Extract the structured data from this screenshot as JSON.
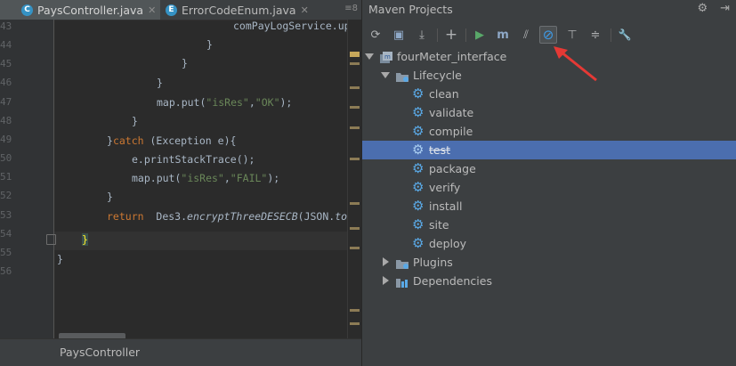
{
  "editor": {
    "tabs": [
      {
        "icon": "C",
        "label": "PaysController.java"
      },
      {
        "icon": "E",
        "label": "ErrorCodeEnum.java"
      }
    ],
    "tab_overflow": "≡8",
    "line_numbers": [
      "43",
      "44",
      "45",
      "46",
      "47",
      "48",
      "49",
      "50",
      "51",
      "52",
      "53",
      "54",
      "55",
      "56"
    ],
    "code": {
      "l43": "comPayLogService.up",
      "l44": "}",
      "l45": "}",
      "l46": "}",
      "l47_a": "map.put(",
      "l47_s1": "\"isRes\"",
      "l47_c": ",",
      "l47_s2": "\"OK\"",
      "l47_e": ");",
      "l48": "}",
      "l49_a": "}",
      "l49_kw": "catch",
      "l49_b": " (Exception e){",
      "l50": "e.printStackTrace();",
      "l51_a": "map.put(",
      "l51_s1": "\"isRes\"",
      "l51_c": ",",
      "l51_s2": "\"FAIL\"",
      "l51_e": ");",
      "l52": "}",
      "l53_kw": "return",
      "l53_a": "  Des3.",
      "l53_it": "encryptThreeDESECB",
      "l53_b": "(JSON.",
      "l53_it2": "toJ",
      "l54": "}",
      "l55": "}"
    },
    "status": "PaysController"
  },
  "maven": {
    "title": "Maven Projects",
    "toolbar": [
      {
        "icon": "refresh-icon",
        "glyph": "⟳"
      },
      {
        "icon": "reimport-folder-icon",
        "glyph": "▣"
      },
      {
        "icon": "download-sources-icon",
        "glyph": "⤓"
      },
      {
        "icon": "add-project-icon",
        "glyph": "+"
      },
      {
        "icon": "run-icon",
        "glyph": "▶"
      },
      {
        "icon": "execute-goal-icon",
        "glyph": "m"
      },
      {
        "icon": "toggle-offline-icon",
        "glyph": "⫽"
      },
      {
        "icon": "skip-tests-icon",
        "glyph": "⊘"
      },
      {
        "icon": "show-dependencies-icon",
        "glyph": "⊤"
      },
      {
        "icon": "collapse-all-icon",
        "glyph": "≑"
      },
      {
        "icon": "settings-wrench-icon",
        "glyph": "🔧"
      }
    ],
    "tree": {
      "project": "fourMeter_interface",
      "lifecycle": "Lifecycle",
      "goals": [
        "clean",
        "validate",
        "compile",
        "test",
        "package",
        "verify",
        "install",
        "site",
        "deploy"
      ],
      "selected_goal": "test",
      "plugins": "Plugins",
      "dependencies": "Dependencies"
    }
  },
  "colors": {
    "selection": "#4b6eaf",
    "annotation_arrow": "#e53935",
    "gear": "#5aa9e6"
  }
}
